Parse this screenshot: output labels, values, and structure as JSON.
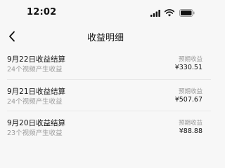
{
  "status_bar": {
    "time": "12:02",
    "icons": [
      "signal-icon",
      "wifi-icon",
      "battery-icon"
    ]
  },
  "nav": {
    "back_icon": "chevron-left-icon",
    "title": "收益明细"
  },
  "records": [
    {
      "title": "9月22日收益结算",
      "subtitle": "24个视频产生收益",
      "status": "预期收益",
      "amount": "¥330.51"
    },
    {
      "title": "9月21日收益结算",
      "subtitle": "24个视频产生收益",
      "status": "预期收益",
      "amount": "¥507.67"
    },
    {
      "title": "9月20日收益结算",
      "subtitle": "23个视频产生收益",
      "status": "预期收益",
      "amount": "¥88.88"
    }
  ]
}
